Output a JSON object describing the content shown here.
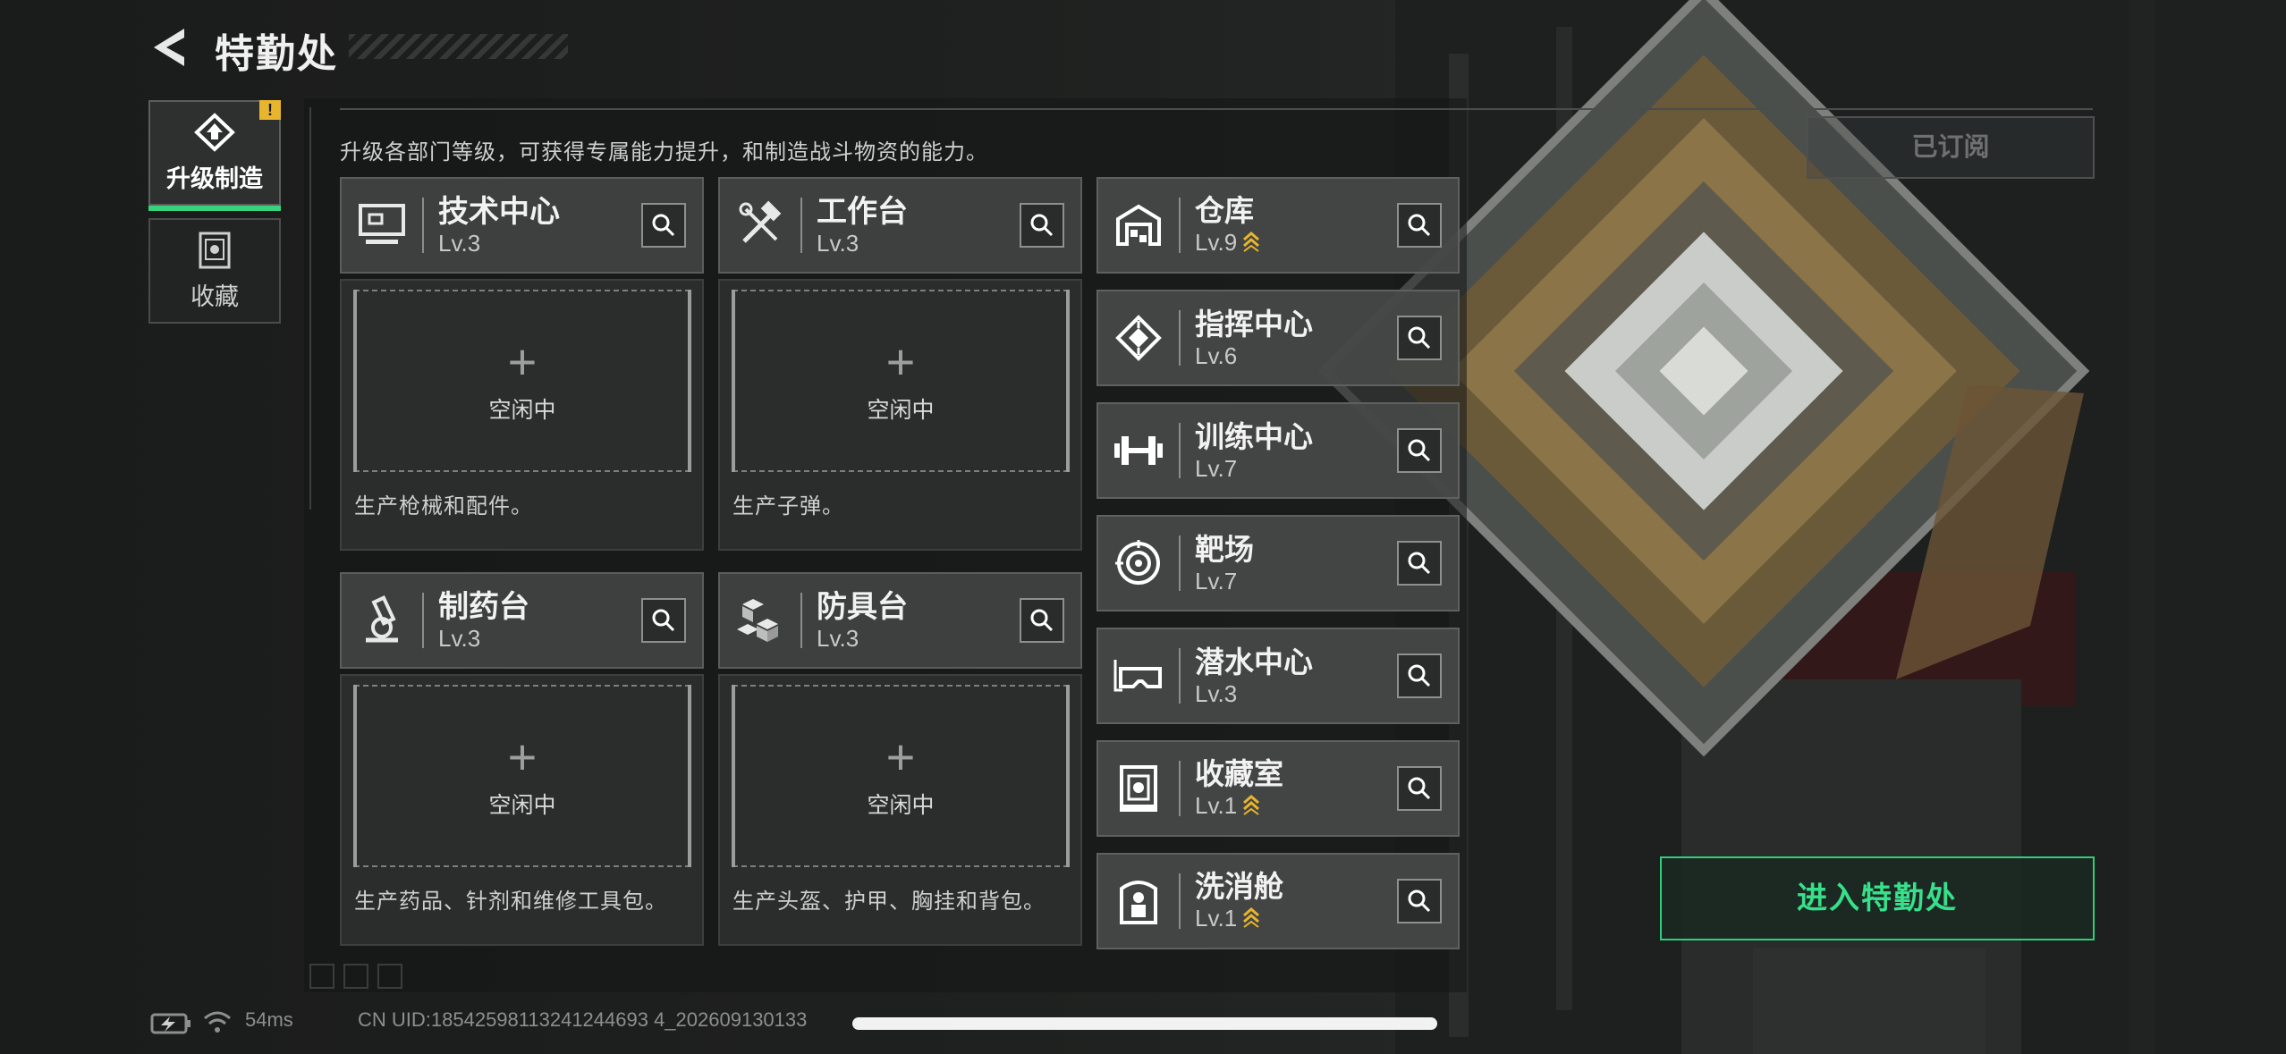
{
  "header": {
    "title": "特勤处"
  },
  "tabs": [
    {
      "label": "升级制造",
      "active": true,
      "badge": "!"
    },
    {
      "label": "收藏",
      "active": false
    }
  ],
  "intro": "升级各部门等级，可获得专属能力提升，和制造战斗物资的能力。",
  "workshops": [
    {
      "name": "技术中心",
      "level": "Lv.3",
      "slot_text": "空闲中",
      "desc": "生产枪械和配件。",
      "icon": "computer-icon"
    },
    {
      "name": "工作台",
      "level": "Lv.3",
      "slot_text": "空闲中",
      "desc": "生产子弹。",
      "icon": "tools-icon"
    },
    {
      "name": "制药台",
      "level": "Lv.3",
      "slot_text": "空闲中",
      "desc": "生产药品、针剂和维修工具包。",
      "icon": "microscope-icon"
    },
    {
      "name": "防具台",
      "level": "Lv.3",
      "slot_text": "空闲中",
      "desc": "生产头盔、护甲、胸挂和背包。",
      "icon": "armor-blocks-icon"
    }
  ],
  "facilities": [
    {
      "name": "仓库",
      "level": "Lv.9",
      "upgradable": true,
      "icon": "warehouse-icon"
    },
    {
      "name": "指挥中心",
      "level": "Lv.6",
      "upgradable": false,
      "icon": "command-chip-icon"
    },
    {
      "name": "训练中心",
      "level": "Lv.7",
      "upgradable": false,
      "icon": "dumbbell-icon"
    },
    {
      "name": "靶场",
      "level": "Lv.7",
      "upgradable": false,
      "icon": "target-icon"
    },
    {
      "name": "潜水中心",
      "level": "Lv.3",
      "upgradable": false,
      "icon": "diving-mask-icon"
    },
    {
      "name": "收藏室",
      "level": "Lv.1",
      "upgradable": true,
      "icon": "collection-case-icon"
    },
    {
      "name": "洗消舱",
      "level": "Lv.1",
      "upgradable": true,
      "icon": "decon-pod-icon"
    }
  ],
  "subscribed_label": "已订阅",
  "enter_button": "进入特勤处",
  "status": {
    "ping": "54ms",
    "uid": "CN UID:18542598113241244693 4_202609130133"
  },
  "colors": {
    "accent_green": "#36d27e",
    "upgrade_gold": "#e7b52e"
  }
}
